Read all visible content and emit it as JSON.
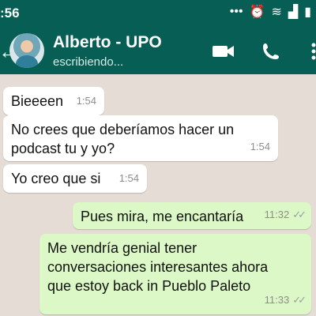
{
  "status": {
    "time": ":56",
    "icons": [
      "dots-icon",
      "alarm-icon",
      "wifi-icon",
      "signal-icon",
      "battery-icon"
    ]
  },
  "contact": {
    "name": "Alberto - UPO",
    "status": "escribiendo..."
  },
  "messages": [
    {
      "dir": "in",
      "text": "Bieeeen",
      "time": "1:54"
    },
    {
      "dir": "in",
      "text": "No crees que deberíamos hacer un podcast tu y yo?",
      "time": "1:54"
    },
    {
      "dir": "in",
      "text": "Yo creo que si",
      "time": "1:54"
    },
    {
      "dir": "out",
      "text": "Pues mira, me encantaría",
      "time": "11:32"
    },
    {
      "dir": "out",
      "text": "Me vendría genial tener conversaciones interesantes ahora que estoy back in Pueblo Paleto",
      "time": "11:33"
    }
  ],
  "colors": {
    "header": "#075e54",
    "chat_background": "#e5ddd5",
    "incoming_bubble": "#ffffff",
    "outgoing_bubble": "#dcf8c6"
  }
}
